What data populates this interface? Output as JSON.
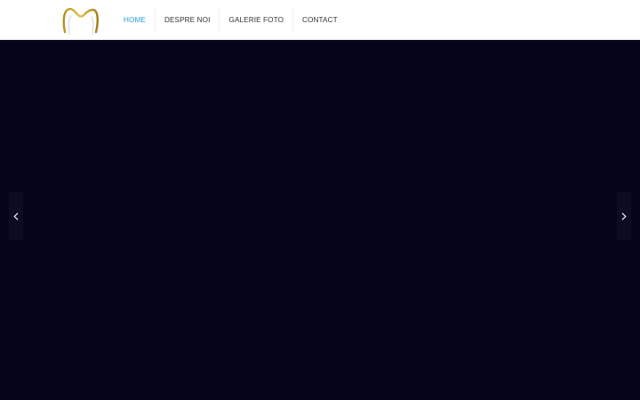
{
  "header": {
    "logo_icon": "tooth-logo-icon",
    "accent_color": "#2aa0d8",
    "logo_color": "#c9a227"
  },
  "nav": {
    "items": [
      {
        "label": "HOME",
        "active": true
      },
      {
        "label": "DESPRE NOI",
        "active": false
      },
      {
        "label": "GALERIE FOTO",
        "active": false
      },
      {
        "label": "CONTACT",
        "active": false
      }
    ]
  },
  "hero": {
    "background_color": "#04041a",
    "prev_icon": "chevron-left-icon",
    "next_icon": "chevron-right-icon"
  }
}
